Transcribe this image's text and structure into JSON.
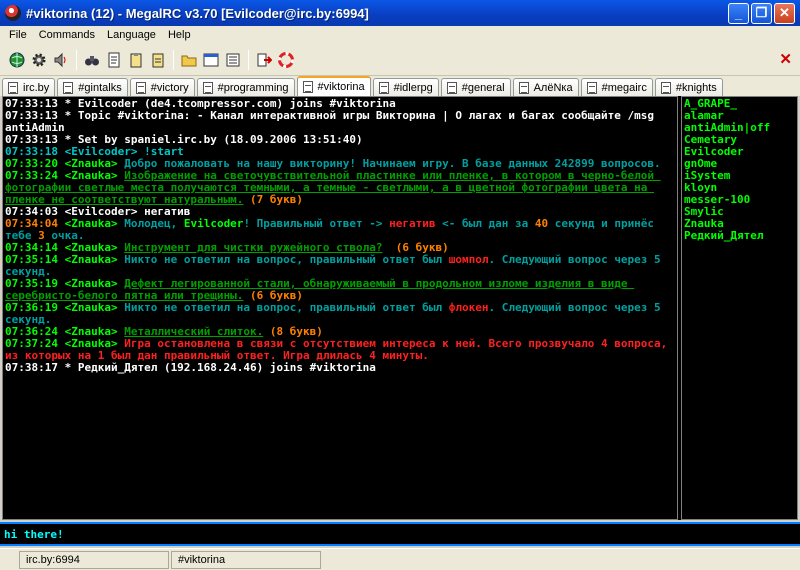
{
  "window": {
    "title": "#viktorina (12) - MegalRC v3.70 [Evilcoder@irc.by:6994]",
    "minimize": "_",
    "maximize": "❐",
    "close": "✕"
  },
  "menu": [
    "File",
    "Commands",
    "Language",
    "Help"
  ],
  "tabs": [
    {
      "label": "irc.by",
      "active": false
    },
    {
      "label": "#gintalks",
      "active": false
    },
    {
      "label": "#victory",
      "active": false
    },
    {
      "label": "#programming",
      "active": false
    },
    {
      "label": "#viktorina",
      "active": true
    },
    {
      "label": "#idlerpg",
      "active": false
    },
    {
      "label": "#general",
      "active": false
    },
    {
      "label": "АлёNка",
      "active": false
    },
    {
      "label": "#megairc",
      "active": false
    },
    {
      "label": "#knights",
      "active": false
    }
  ],
  "chat": [
    [
      {
        "t": "07:33:13 * Evilcoder (de4.tcompressor.com) joins #viktorina",
        "c": "white"
      }
    ],
    [
      {
        "t": "07:33:13 * Topic #viktorina: - Канал интерактивной игры Викторина | О лагах и багах сообщайте /msg antiAdmin",
        "c": "white"
      }
    ],
    [
      {
        "t": "07:33:13 * Set by spaniel.irc.by (18.09.2006 13:51:40)",
        "c": "white"
      }
    ],
    [
      {
        "t": "07:33:18 <Evilcoder> !start",
        "c": "cyan"
      }
    ],
    [
      {
        "t": "07:33:20 <Znauka> ",
        "c": "green"
      },
      {
        "t": "Добро пожаловать на нашу викторину! Начинаем игру. В базе данных 242899 вопросов.",
        "c": "teal"
      }
    ],
    [
      {
        "t": "07:33:24 <Znauka> ",
        "c": "green"
      },
      {
        "t": "Изображение на светочувствительной пластинке или пленке, в котором в черно-белой фотографии светлые места получаются темными, а темные - светлыми, а в цветной фотографии цвета на пленке не соответствуют натуральным.",
        "c": "green-u"
      },
      {
        "t": " (7 букв)",
        "c": "orange"
      }
    ],
    [
      {
        "t": "07:34:03 <Evilcoder> негатив",
        "c": "white"
      }
    ],
    [
      {
        "t": "07:34:04 ",
        "c": "orange"
      },
      {
        "t": "<Znauka> ",
        "c": "green"
      },
      {
        "t": "Молодец, ",
        "c": "teal"
      },
      {
        "t": "Evilcoder",
        "c": "green"
      },
      {
        "t": "! Правильный ответ -> ",
        "c": "teal"
      },
      {
        "t": "негатив",
        "c": "red"
      },
      {
        "t": " <- был дан за ",
        "c": "teal"
      },
      {
        "t": "40",
        "c": "orange"
      },
      {
        "t": " секунд и принёс тебе ",
        "c": "teal"
      },
      {
        "t": "3",
        "c": "orange"
      },
      {
        "t": " очка.",
        "c": "teal"
      }
    ],
    [
      {
        "t": "07:34:14 <Znauka> ",
        "c": "green"
      },
      {
        "t": "Инструмент для чистки ружейного ствола?",
        "c": "green-u"
      },
      {
        "t": "  (6 букв)",
        "c": "orange"
      }
    ],
    [
      {
        "t": "07:35:14 <Znauka> ",
        "c": "green"
      },
      {
        "t": "Никто не ответил на вопрос, правильный ответ был ",
        "c": "teal"
      },
      {
        "t": "шомпол",
        "c": "red"
      },
      {
        "t": ". Следующий вопрос через 5 секунд.",
        "c": "teal"
      }
    ],
    [
      {
        "t": "07:35:19 <Znauka> ",
        "c": "green"
      },
      {
        "t": "Дефект легированной стали, обнаруживаемый в продольном изломе изделия в виде серебристо-белого пятна или трещины.",
        "c": "green-u"
      },
      {
        "t": " (6 букв)",
        "c": "orange"
      }
    ],
    [
      {
        "t": "07:36:19 <Znauka> ",
        "c": "green"
      },
      {
        "t": "Никто не ответил на вопрос, правильный ответ был ",
        "c": "teal"
      },
      {
        "t": "флокен",
        "c": "red"
      },
      {
        "t": ". Следующий вопрос через 5 секунд.",
        "c": "teal"
      }
    ],
    [
      {
        "t": "07:36:24 <Znauka> ",
        "c": "green"
      },
      {
        "t": "Металлический слиток.",
        "c": "green-u"
      },
      {
        "t": " (8 букв)",
        "c": "orange"
      }
    ],
    [
      {
        "t": "07:37:24 <Znauka> ",
        "c": "green"
      },
      {
        "t": "Игра остановлена в связи с отсутствием интереса к ней. Всего прозвучало 4 вопроса, из которых на 1 был дан правильный ответ. Игра длилась 4 минуты.",
        "c": "red"
      }
    ],
    [
      {
        "t": "07:38:17 * Редкий_Дятел (192.168.24.46) joins #viktorina",
        "c": "white"
      }
    ]
  ],
  "nicks": [
    "A_GRAPE_",
    "alamar",
    "antiAdmin|off",
    "Cemetary",
    "Evilcoder",
    "gnOme",
    "iSystem",
    "kloyn",
    "messer-100",
    "Smylic",
    "Znauka",
    "Редкий_Дятел"
  ],
  "input": {
    "value": "hi there!"
  },
  "status": {
    "server": "irc.by:6994",
    "channel": "#viktorina"
  },
  "icons": [
    "globe-icon",
    "gear-icon",
    "speaker-icon",
    "binoculars-icon",
    "document-icon",
    "clipboard-icon",
    "clipboard-alt-icon",
    "folder-icon",
    "window-icon",
    "list-icon",
    "exit-icon",
    "lifebuoy-icon"
  ]
}
